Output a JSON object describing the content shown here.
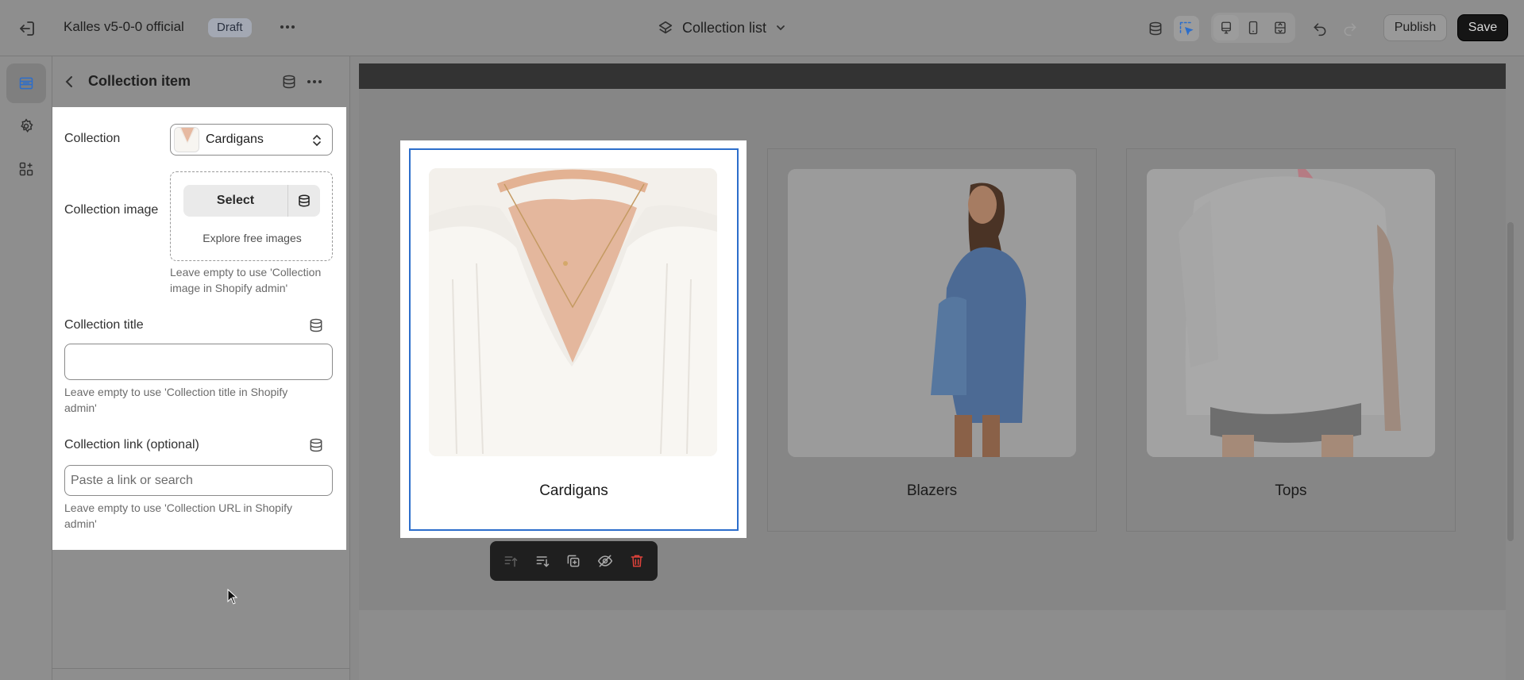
{
  "topbar": {
    "store_name": "Kalles v5-0-0 official",
    "status_badge": "Draft",
    "template_label": "Collection list",
    "publish_label": "Publish",
    "save_label": "Save"
  },
  "panel": {
    "title": "Collection item",
    "collection_label": "Collection",
    "collection_value": "Cardigans",
    "image_label": "Collection image",
    "image_select_label": "Select",
    "image_explore_label": "Explore free images",
    "image_help": "Leave empty to use 'Collection image in Shopify admin'",
    "title_label": "Collection title",
    "title_value": "",
    "title_help": "Leave empty to use 'Collection title in Shopify admin'",
    "link_label": "Collection link (optional)",
    "link_placeholder": "Paste a link or search",
    "link_help": "Leave empty to use 'Collection URL in Shopify admin'"
  },
  "preview": {
    "collections": [
      {
        "title": "Cardigans",
        "selected": true
      },
      {
        "title": "Blazers",
        "selected": false
      },
      {
        "title": "Tops",
        "selected": false
      }
    ]
  },
  "colors": {
    "accent": "#2c6ecb",
    "delete": "#e0423b",
    "save_button": "#151515",
    "overlay_gray": "#8e8e8e"
  }
}
